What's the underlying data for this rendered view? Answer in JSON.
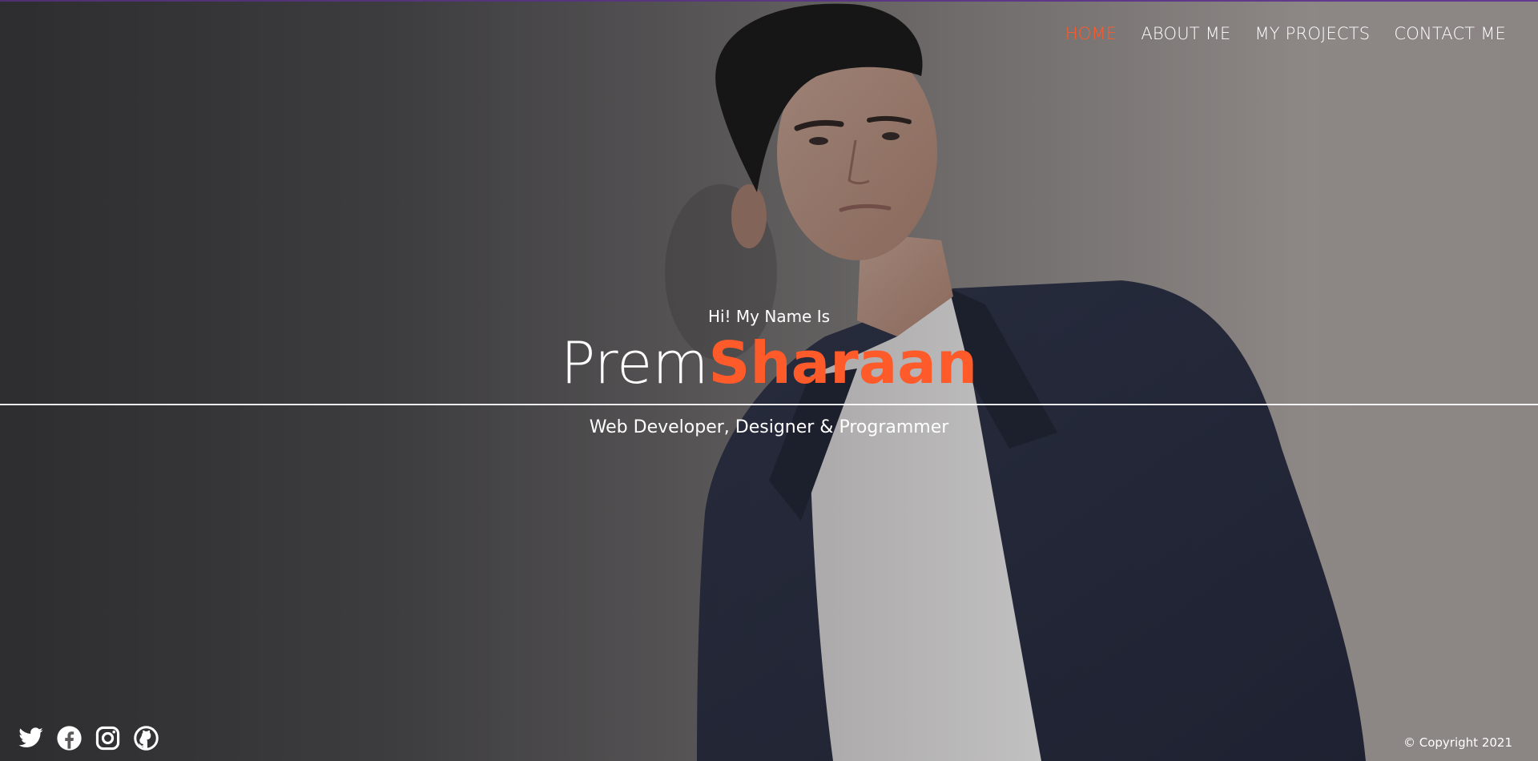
{
  "nav": {
    "items": [
      {
        "label": "HOME",
        "active": true
      },
      {
        "label": "ABOUT ME",
        "active": false
      },
      {
        "label": "MY PROJECTS",
        "active": false
      },
      {
        "label": "CONTACT ME",
        "active": false
      }
    ]
  },
  "hero": {
    "greeting": "Hi! My Name Is",
    "first_name": "Prem",
    "last_name": "Sharaan",
    "tagline": "Web Developer, Designer & Programmer"
  },
  "social": {
    "icons": [
      "twitter-icon",
      "facebook-icon",
      "instagram-icon",
      "github-icon"
    ]
  },
  "footer": {
    "copyright": "© Copyright 2021"
  },
  "colors": {
    "accent": "#ff5a2a",
    "text": "#ffffff",
    "top_border": "#6e3fa1"
  }
}
